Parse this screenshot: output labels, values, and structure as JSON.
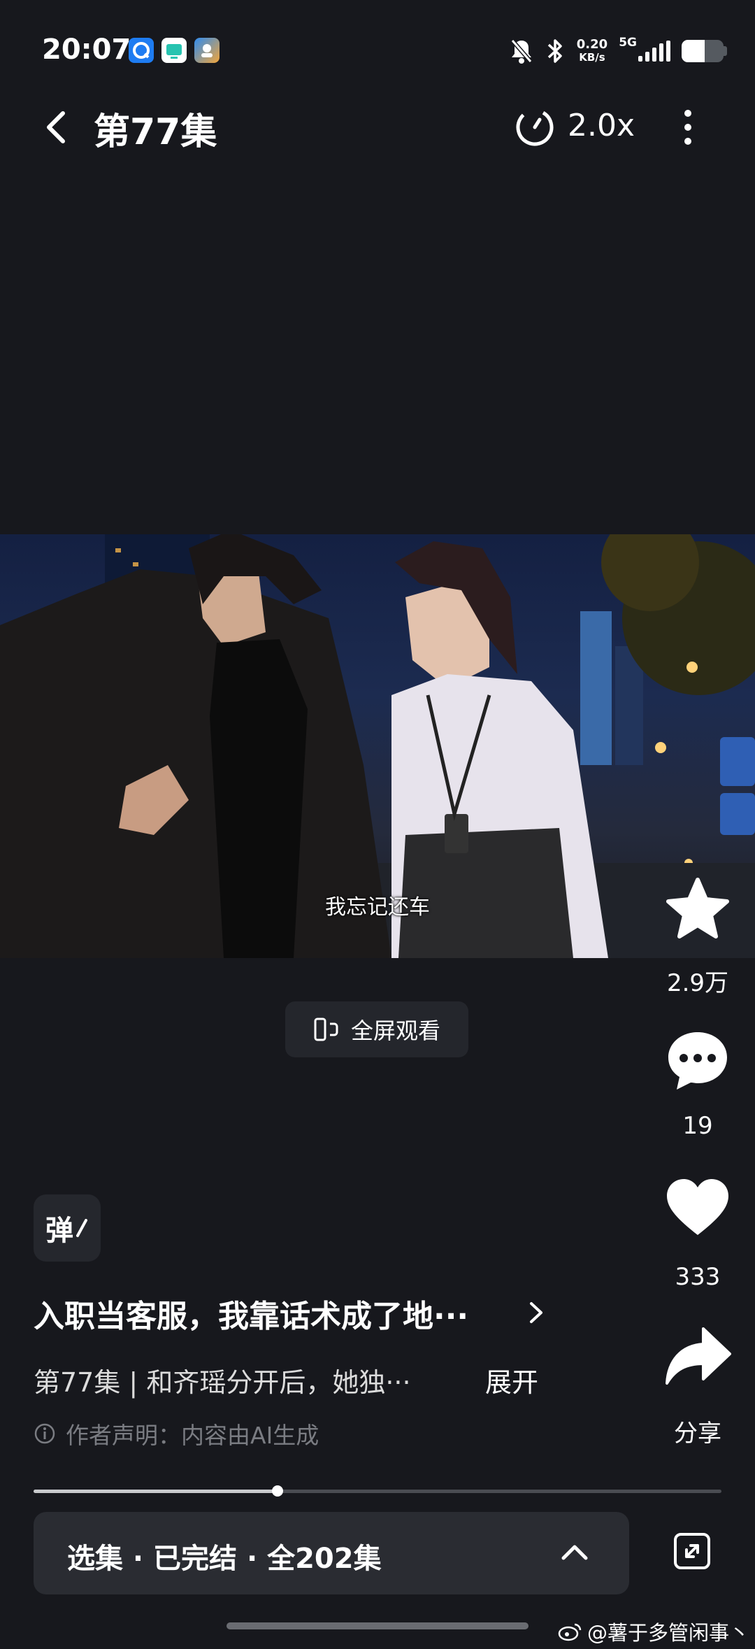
{
  "status_bar": {
    "time": "20:07",
    "net_speed_value": "0.20",
    "net_speed_unit": "KB/s",
    "network_type": "5G",
    "battery_level": 0.55,
    "app_icons": [
      "qq-browser-icon",
      "tv-app-icon",
      "assistant-app-icon"
    ],
    "app_icon_colors": [
      "#1e7cf2",
      "#27c3b0",
      "#2f8cf0"
    ]
  },
  "header": {
    "title": "第77集",
    "speed_label": "2.0x"
  },
  "video": {
    "subtitle": "我忘记还车"
  },
  "fullscreen_button": {
    "label": "全屏观看"
  },
  "right_rail": {
    "favorite_count": "2.9万",
    "comment_count": "19",
    "like_count": "333",
    "share_label": "分享"
  },
  "danmu": {
    "label": "弹"
  },
  "info": {
    "series_title": "入职当客服，我靠话术成了地···",
    "episode_desc": "第77集 | 和齐瑶分开后，她独···",
    "expand_label": "展开",
    "notice": "作者声明：内容由AI生成"
  },
  "progress": {
    "fraction": 0.355
  },
  "episode_bar": {
    "label": "选集 · 已完结 · 全202集"
  },
  "watermark": {
    "text": "@薯于多管闲事丶"
  },
  "colors": {
    "background": "#17181d",
    "panel": "#2a2c32",
    "muted_text": "#7a7c82"
  }
}
